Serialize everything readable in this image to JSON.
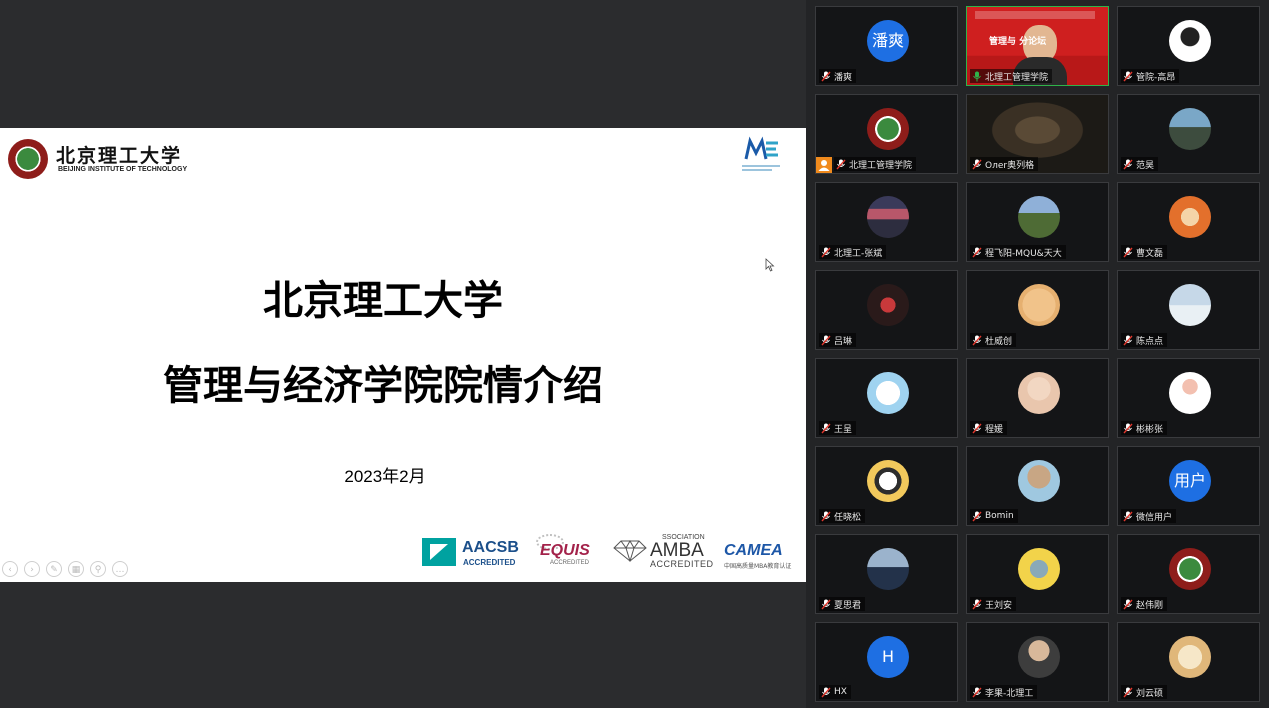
{
  "slide": {
    "university_cn": "北京理工大学",
    "university_en": "BEIJING INSTITUTE OF TECHNOLOGY",
    "title_line1": "北京理工大学",
    "title_line2": "管理与经济学院院情介绍",
    "date": "2023年2月",
    "accreditations": {
      "aacsb": "AACSB",
      "aacsb_sub": "ACCREDITED",
      "equis": "EQUIS",
      "equis_sub": "ACCREDITED",
      "amba_top": "SSOCIATION",
      "amba": "AMBA",
      "amba_sub": "ACCREDITED",
      "camea": "CAMEA",
      "camea_sub": "中国高质量MBA教育认证"
    }
  },
  "participants": [
    {
      "name": "潘爽",
      "avatar_text": "潘爽"
    },
    {
      "name": "北理工管理学院",
      "video_text": "管理与 分论坛",
      "speaking": true
    },
    {
      "name": "管院-高昂"
    },
    {
      "name": "北理工管理学院",
      "host": true
    },
    {
      "name": "Oлer奥列格"
    },
    {
      "name": "范昊"
    },
    {
      "name": "北理工-张斌"
    },
    {
      "name": "程飞阳-MQU&天大"
    },
    {
      "name": "曹文磊"
    },
    {
      "name": "吕琳"
    },
    {
      "name": "杜威创"
    },
    {
      "name": "陈点点"
    },
    {
      "name": "王呈"
    },
    {
      "name": "程媛"
    },
    {
      "name": "彬彬张"
    },
    {
      "name": "任晓松"
    },
    {
      "name": "Bomin"
    },
    {
      "name": "微信用户",
      "avatar_text": "用户"
    },
    {
      "name": "夏思君"
    },
    {
      "name": "王刘安"
    },
    {
      "name": "赵伟刚"
    },
    {
      "name": "HX",
      "avatar_text": "H"
    },
    {
      "name": "李果-北理工"
    },
    {
      "name": "刘云硕"
    }
  ],
  "colors": {
    "background": "#2b2c2e",
    "avatar_blue": "#1e6fe3",
    "speaking_border": "#2fb34a",
    "accent_green": "#3b8a3e",
    "accent_red": "#8e1d1a"
  }
}
